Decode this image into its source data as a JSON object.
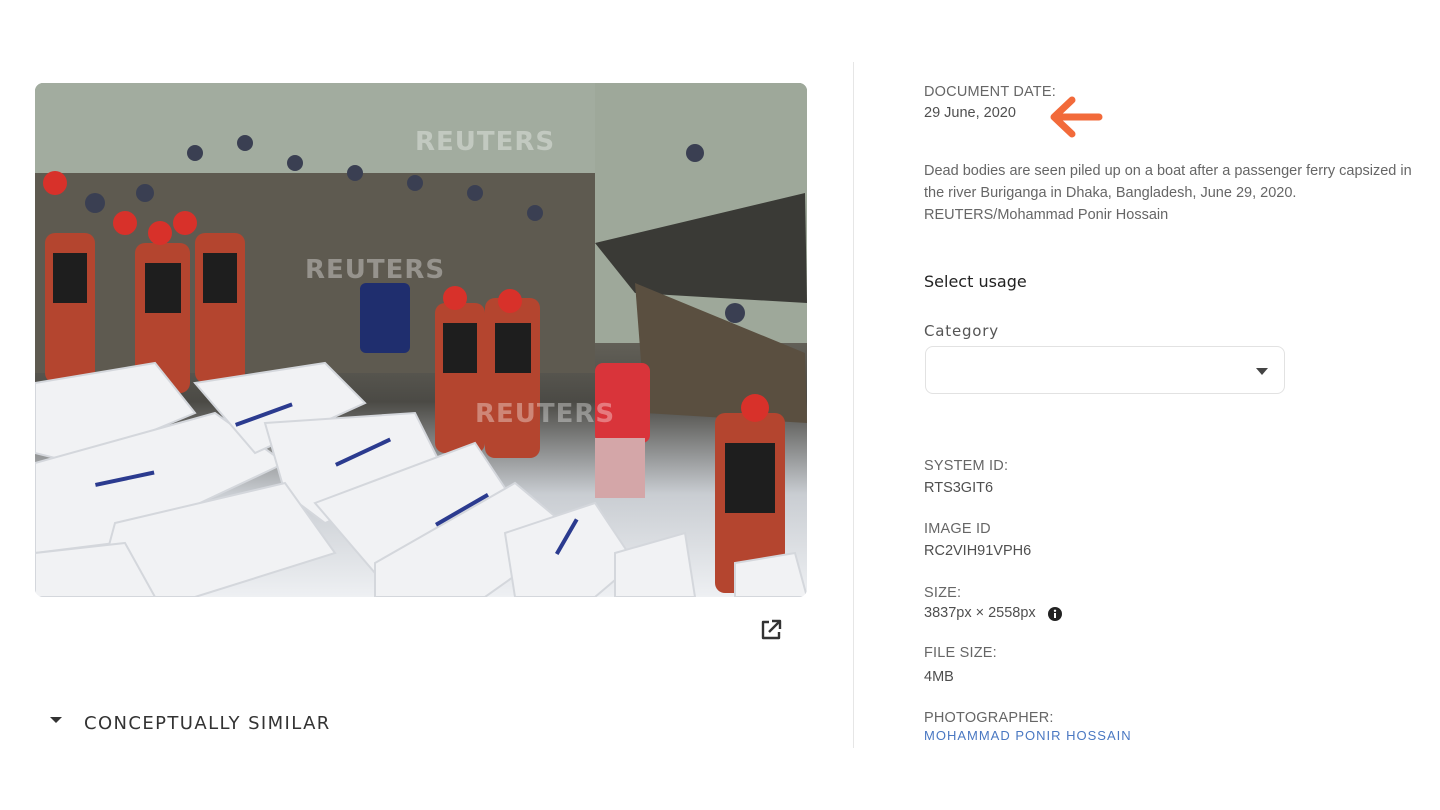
{
  "photo": {
    "alt": "Dead bodies piled up on a boat after a passenger ferry capsized",
    "watermark": "REUTERS"
  },
  "similar": {
    "label": "CONCEPTUALLY SIMILAR"
  },
  "meta": {
    "document_date_label": "DOCUMENT DATE:",
    "document_date_value": "29 June, 2020",
    "description": "Dead bodies are seen piled up on a boat after a passenger ferry capsized in the river Buriganga in Dhaka, Bangladesh, June 29, 2020. REUTERS/Mohammad Ponir Hossain",
    "system_id_label": "SYSTEM ID:",
    "system_id_value": "RTS3GIT6",
    "image_id_label": "IMAGE ID",
    "image_id_value": "RC2VIH91VPH6",
    "size_label": "SIZE:",
    "size_value": "3837px × 2558px",
    "file_size_label": "FILE SIZE:",
    "file_size_value": "4MB",
    "photographer_label": "PHOTOGRAPHER:",
    "photographer_value": "MOHAMMAD PONIR HOSSAIN"
  },
  "usage": {
    "title": "Select usage",
    "category_label": "Category",
    "category_value": ""
  },
  "colors": {
    "accent_arrow": "#f26a3a",
    "link": "#4a78c2"
  }
}
